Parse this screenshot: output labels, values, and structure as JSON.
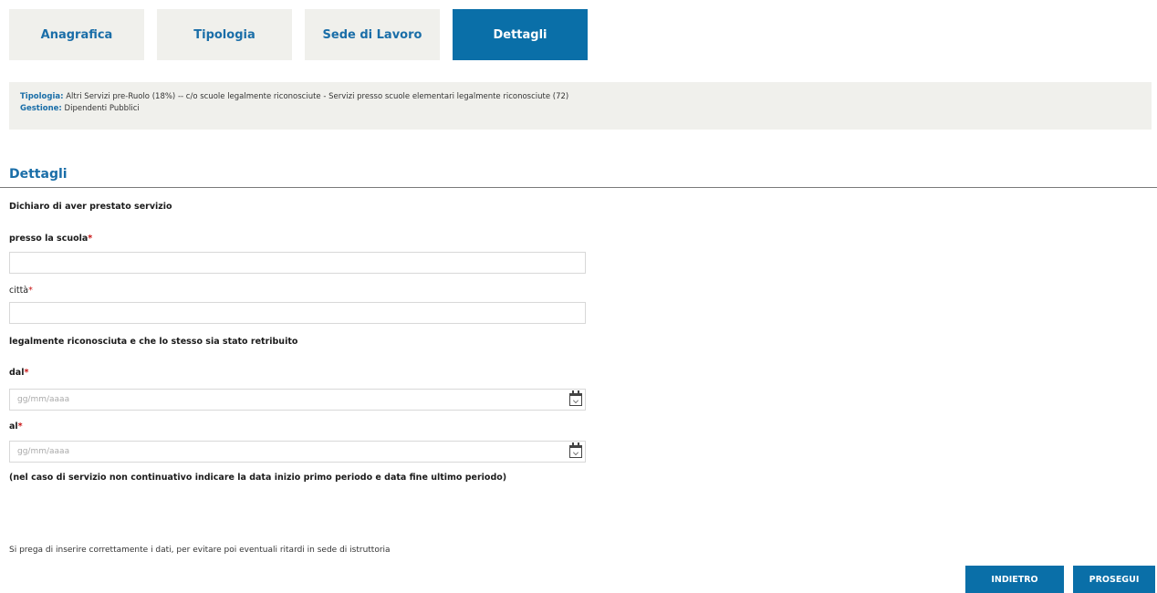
{
  "tabs": [
    {
      "label": "Anagrafica",
      "active": false
    },
    {
      "label": "Tipologia",
      "active": false
    },
    {
      "label": "Sede di Lavoro",
      "active": false
    },
    {
      "label": "Dettagli",
      "active": true
    }
  ],
  "info": {
    "tipologia_label": "Tipologia:",
    "tipologia_value": "Altri Servizi pre-Ruolo (18%) -- c/o scuole legalmente riconosciute - Servizi presso scuole elementari legalmente riconosciute (72)",
    "gestione_label": "Gestione:",
    "gestione_value": "Dipendenti Pubblici"
  },
  "section": {
    "title": "Dettagli",
    "intro": "Dichiaro di aver prestato servizio"
  },
  "fields": {
    "scuola": {
      "label": "presso la scuola",
      "required_mark": "*",
      "value": ""
    },
    "citta": {
      "label": "città",
      "required_mark": "*",
      "value": ""
    },
    "middle_text": "legalmente riconosciuta e che lo stesso sia stato retribuito",
    "dal": {
      "label": "dal",
      "required_mark": "*",
      "placeholder": "gg/mm/aaaa"
    },
    "al": {
      "label": "al",
      "required_mark": "*",
      "placeholder": "gg/mm/aaaa"
    },
    "hint": "(nel caso di servizio non continuativo indicare la data inizio primo periodo e data fine ultimo periodo)"
  },
  "note": "Si prega di inserire correttamente i dati, per evitare poi eventuali ritardi in sede di istruttoria",
  "buttons": {
    "back": "INDIETRO",
    "next": "PROSEGUI"
  },
  "colors": {
    "accent": "#0a6fa8",
    "tab_bg": "#f0f0ec",
    "required": "#c81414"
  }
}
